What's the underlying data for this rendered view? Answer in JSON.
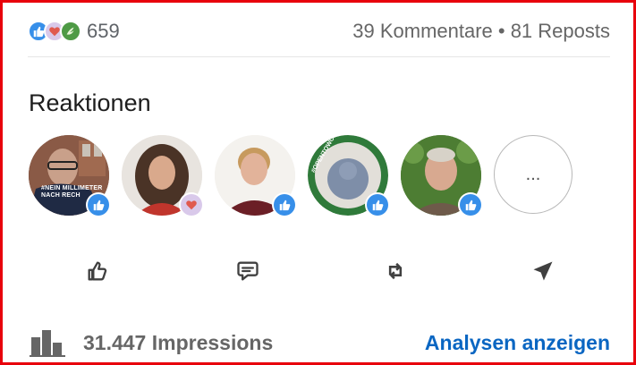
{
  "post_stats": {
    "reaction_count": "659",
    "comments_reposts": "39 Kommentare • 81 Reposts",
    "reaction_icons": [
      "like-icon",
      "love-icon",
      "support-icon"
    ]
  },
  "reactions_section": {
    "title": "Reaktionen",
    "reactors": [
      {
        "avatar": "person-glasses-photo",
        "badge_icon": "like-icon",
        "avatar_text": "#NEIN MILLIMETER NACH RECH"
      },
      {
        "avatar": "woman-curly-hair-photo",
        "badge_icon": "love-icon"
      },
      {
        "avatar": "man-blond-photo",
        "badge_icon": "like-icon"
      },
      {
        "avatar": "open-to-work-placeholder",
        "badge_icon": "like-icon",
        "avatar_text": "#OPENTOWORK"
      },
      {
        "avatar": "older-man-photo",
        "badge_icon": "like-icon"
      }
    ],
    "more_label": "..."
  },
  "actions": [
    {
      "name": "like-button",
      "icon": "thumbs-up-icon"
    },
    {
      "name": "comment-button",
      "icon": "comment-icon"
    },
    {
      "name": "repost-button",
      "icon": "repost-icon"
    },
    {
      "name": "send-button",
      "icon": "send-icon"
    }
  ],
  "footer": {
    "impressions": "31.447 Impressions",
    "analytics_link": "Analysen anzeigen"
  },
  "colors": {
    "frame_border": "#e8000b",
    "link": "#0a66c2",
    "like_blue": "#378fe9",
    "love_purple": "#a98bd0",
    "support_green": "#4e9a45"
  }
}
